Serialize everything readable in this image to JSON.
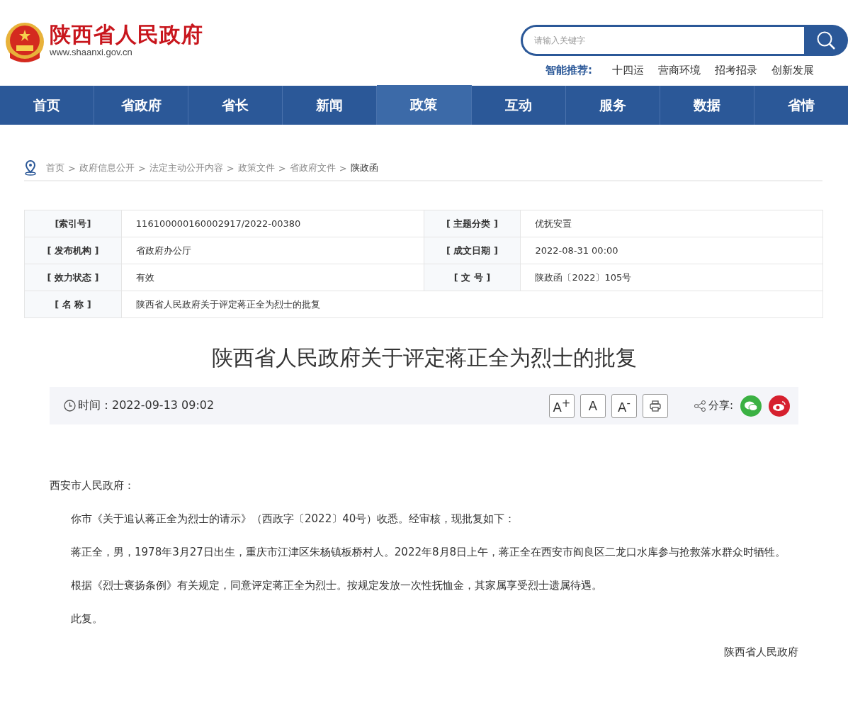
{
  "header": {
    "site_name": "陕西省人民政府",
    "site_url": "www.shaanxi.gov.cn",
    "search": {
      "placeholder": "请输入关键字"
    },
    "recommend": {
      "label": "智能推荐:",
      "links": [
        "十四运",
        "营商环境",
        "招考招录",
        "创新发展"
      ]
    }
  },
  "nav": [
    {
      "label": "首页",
      "selected": false
    },
    {
      "label": "省政府",
      "selected": false
    },
    {
      "label": "省长",
      "selected": false
    },
    {
      "label": "新闻",
      "selected": false
    },
    {
      "label": "政策",
      "selected": true
    },
    {
      "label": "互动",
      "selected": false
    },
    {
      "label": "服务",
      "selected": false
    },
    {
      "label": "数据",
      "selected": false
    },
    {
      "label": "省情",
      "selected": false
    }
  ],
  "breadcrumb": {
    "separator": ">",
    "items": [
      "首页",
      "政府信息公开",
      "法定主动公开内容",
      "政策文件",
      "省政府文件",
      "陕政函"
    ]
  },
  "info_table": [
    [
      {
        "label": "[索引号]",
        "value": "116100000160002917/2022-00380"
      },
      {
        "label": "[ 主题分类 ]",
        "value": "优抚安置"
      }
    ],
    [
      {
        "label": "[ 发布机构 ]",
        "value": "省政府办公厅"
      },
      {
        "label": "[ 成文日期 ]",
        "value": "2022-08-31 00:00"
      }
    ],
    [
      {
        "label": "[ 效力状态 ]",
        "value": "有效"
      },
      {
        "label": "[ 文 号 ]",
        "value": "陕政函〔2022〕105号"
      }
    ],
    [
      {
        "label": "[ 名 称 ]",
        "value": "陕西省人民政府关于评定蒋正全为烈士的批复"
      }
    ]
  ],
  "article": {
    "title": "陕西省人民政府关于评定蒋正全为烈士的批复",
    "time": "时间：2022-09-13 09:02",
    "font_buttons": [
      "A$^{+}$",
      "A",
      "A$^{-}$"
    ],
    "share_label": "分享:",
    "salutation": "西安市人民政府：",
    "paragraphs": [
      "你市《关于追认蒋正全为烈士的请示》（西政字〔2022〕40号）收悉。经审核，现批复如下：",
      "蒋正全，男，1978年3月27日出生，重庆市江津区朱杨镇板桥村人。2022年8月8日上午，蒋正全在西安市阎良区二龙口水库参与抢救落水群众时牺牲。",
      "根据《烈士褒扬条例》有关规定，同意评定蒋正全为烈士。按规定发放一次性抚恤金，其家属享受烈士遗属待遇。",
      "此复。"
    ],
    "signature": "陕西省人民政府"
  }
}
